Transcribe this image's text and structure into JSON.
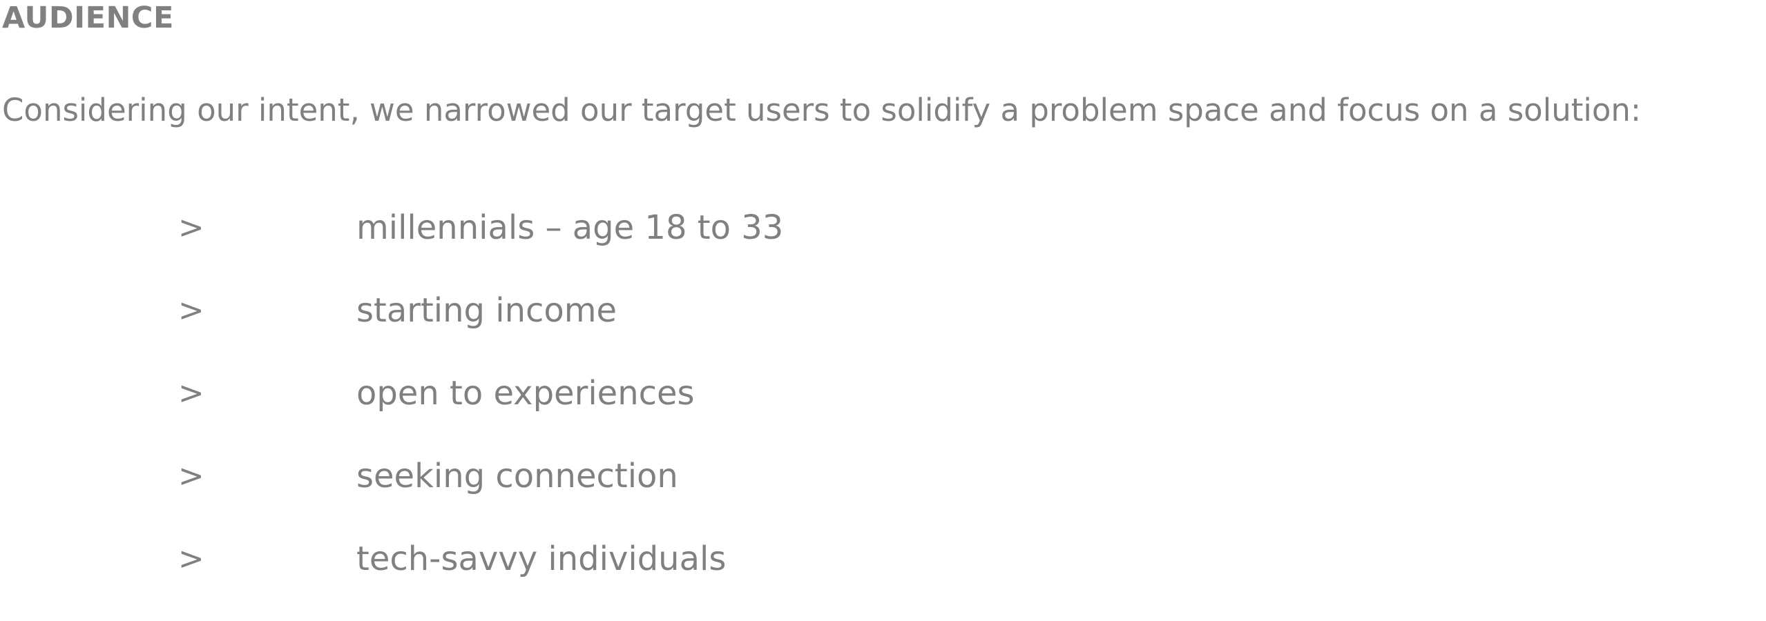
{
  "section": {
    "heading": "AUDIENCE",
    "intro": "Considering our intent, we narrowed our target users to solidify a problem space and focus on a solution:"
  },
  "audience_list": {
    "bullet_glyph": ">",
    "items": [
      {
        "label": "millennials – age 18 to 33"
      },
      {
        "label": "starting income"
      },
      {
        "label": "open to experiences"
      },
      {
        "label": "seeking connection"
      },
      {
        "label": "tech-savvy individuals"
      }
    ]
  },
  "colors": {
    "text": "#808080",
    "background": "#ffffff"
  }
}
